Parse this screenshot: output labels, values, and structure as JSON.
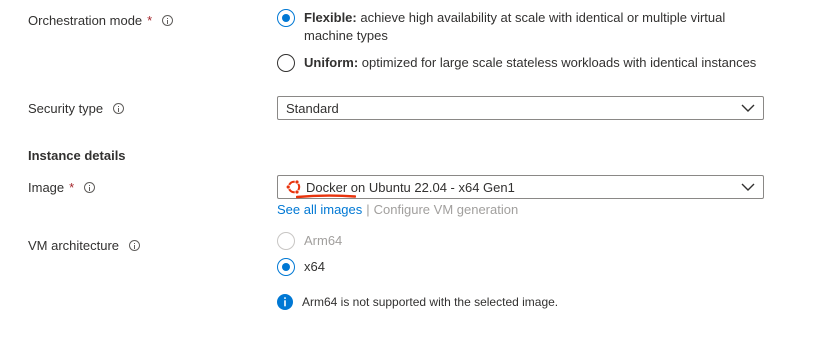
{
  "orchestration": {
    "label": "Orchestration mode",
    "required_mark": "*",
    "options": [
      {
        "title": "Flexible:",
        "desc_line1": " achieve high availability at scale with identical or multiple virtual",
        "desc_line2": "machine types",
        "selected": true
      },
      {
        "title": "Uniform:",
        "desc_line1": " optimized for large scale stateless workloads with identical instances",
        "selected": false
      }
    ]
  },
  "security": {
    "label": "Security type",
    "value": "Standard"
  },
  "instance_details": {
    "title": "Instance details"
  },
  "image": {
    "label": "Image",
    "required_mark": "*",
    "value_highlight": "Docker",
    "value_rest": " on Ubuntu 22.04 - x64 Gen1",
    "icon": "ubuntu-logo-icon",
    "see_all_link": "See all images",
    "separator": "|",
    "configure_link": "Configure VM generation"
  },
  "vm_architecture": {
    "label": "VM architecture",
    "options": [
      {
        "label": "Arm64",
        "selected": false,
        "disabled": true
      },
      {
        "label": "x64",
        "selected": true,
        "disabled": false
      }
    ],
    "notice": "Arm64 is not supported with the selected image."
  },
  "colors": {
    "accent": "#0078d4",
    "required": "#a4262c",
    "annotation": "#e8330c"
  }
}
